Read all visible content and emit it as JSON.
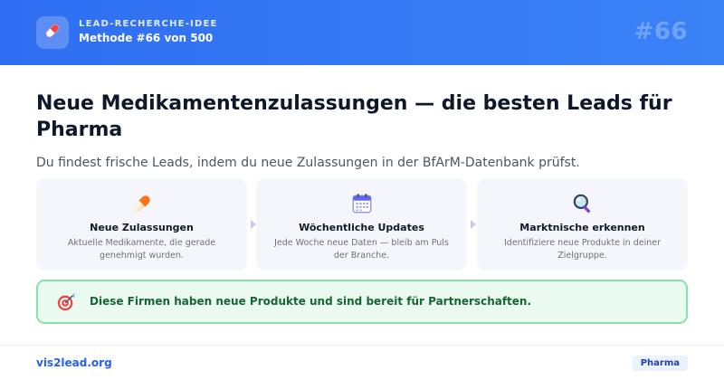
{
  "header": {
    "icon": "pill-icon",
    "kicker": "LEAD-RECHERCHE-IDEE",
    "method": "Methode #66 von 500",
    "number": "#66"
  },
  "main": {
    "title": "Neue Medikamentenzulassungen — die besten Leads für Pharma",
    "subtitle": "Du findest frische Leads, indem du neue Zulassungen in der BfArM-Datenbank prüfst."
  },
  "steps": [
    {
      "icon": "pill-icon",
      "title": "Neue Zulassungen",
      "desc": "Aktuelle Medikamente, die gerade genehmigt wurden."
    },
    {
      "icon": "calendar-icon",
      "title": "Wöchentliche Updates",
      "desc": "Jede Woche neue Daten — bleib am Puls der Branche."
    },
    {
      "icon": "magnifier-icon",
      "title": "Marktnische erkennen",
      "desc": "Identifiziere neue Produkte in deiner Zielgruppe."
    }
  ],
  "callout": {
    "icon": "target-icon",
    "text": "Diese Firmen haben neue Produkte und sind bereit für Partnerschaften."
  },
  "footer": {
    "link": "vis2lead.org",
    "badge": "Pharma"
  },
  "colors": {
    "header_start": "#2f6ef2",
    "header_end": "#3b82f6",
    "callout_bg": "#eafaf0",
    "callout_border": "#86e2a8",
    "callout_text": "#166534",
    "link": "#2563eb"
  }
}
